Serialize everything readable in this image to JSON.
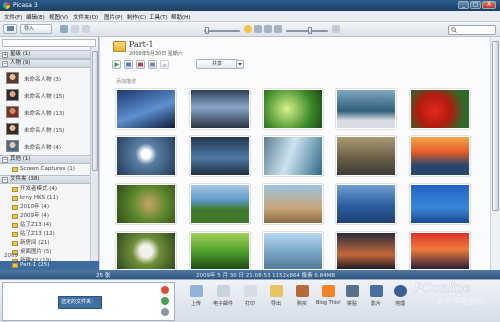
{
  "window": {
    "title": "Picasa 3",
    "min": "_",
    "max": "□",
    "close": "X"
  },
  "menu": [
    "文件(F)",
    "编辑(E)",
    "视图(V)",
    "文件夹(O)",
    "图片(P)",
    "制作(C)",
    "工具(T)",
    "帮助(H)"
  ],
  "toolbar": {
    "import_label": "导入",
    "filter_label": "选项卡"
  },
  "sidebar": {
    "sections": [
      {
        "label": "星级 (1)"
      },
      {
        "label": "人物 (9)"
      }
    ],
    "people": [
      {
        "label": "未命名人物 (3)"
      },
      {
        "label": "未命名人物 (15)"
      },
      {
        "label": "未命名人物 (13)"
      },
      {
        "label": "未命名人物 (15)"
      },
      {
        "label": "未命名人物 (4)"
      }
    ],
    "other_section": "其他 (1)",
    "screen_captures": "Screen Captures (1)",
    "folders_section": "文件夹 (38)",
    "folders": [
      {
        "label": "开发者模式 (4)"
      },
      {
        "label": "krny HKS (11)"
      },
      {
        "label": "2010年 (4)"
      },
      {
        "label": "2009年 (4)"
      },
      {
        "label": "站了Z13 (4)"
      },
      {
        "label": "站了Z13 (12)"
      },
      {
        "label": "新房间 (21)"
      },
      {
        "label": "桌面图片 (5)"
      },
      {
        "label": "新建X2 (19)"
      }
    ],
    "year": "2009",
    "selected_folder": "Part-1 (25)"
  },
  "album": {
    "title": "Part-1",
    "date": "2009年5月30日 星期六",
    "play_label": "共享",
    "section": "添加描述"
  },
  "status": {
    "count": "25 张",
    "info": "2009年 5 月 30 日   21:08:53   1152x864 像素   6.84MB"
  },
  "tray": {
    "selection": "选定的文件夹：25照片",
    "buttons": [
      {
        "label": "上传",
        "color": "#8fb3d9"
      },
      {
        "label": "电子邮件",
        "color": "#c9d3de"
      },
      {
        "label": "打印",
        "color": "#d6dde5"
      },
      {
        "label": "导出",
        "color": "#e6c461"
      },
      {
        "label": "购买",
        "color": "#b46a3a"
      },
      {
        "label": "Blog This!",
        "color": "#f08228"
      },
      {
        "label": "拼贴",
        "color": "#596f8a"
      },
      {
        "label": "影片",
        "color": "#4a6fa0"
      },
      {
        "label": "地理",
        "color": "#3b5f92"
      }
    ]
  },
  "watermark": {
    "brand": "PConline",
    "sub": "太平洋电脑网"
  },
  "colors": {
    "titlebar": "#2d5d8a",
    "selection": "#3c6c9c",
    "status": "#4f79a3"
  }
}
